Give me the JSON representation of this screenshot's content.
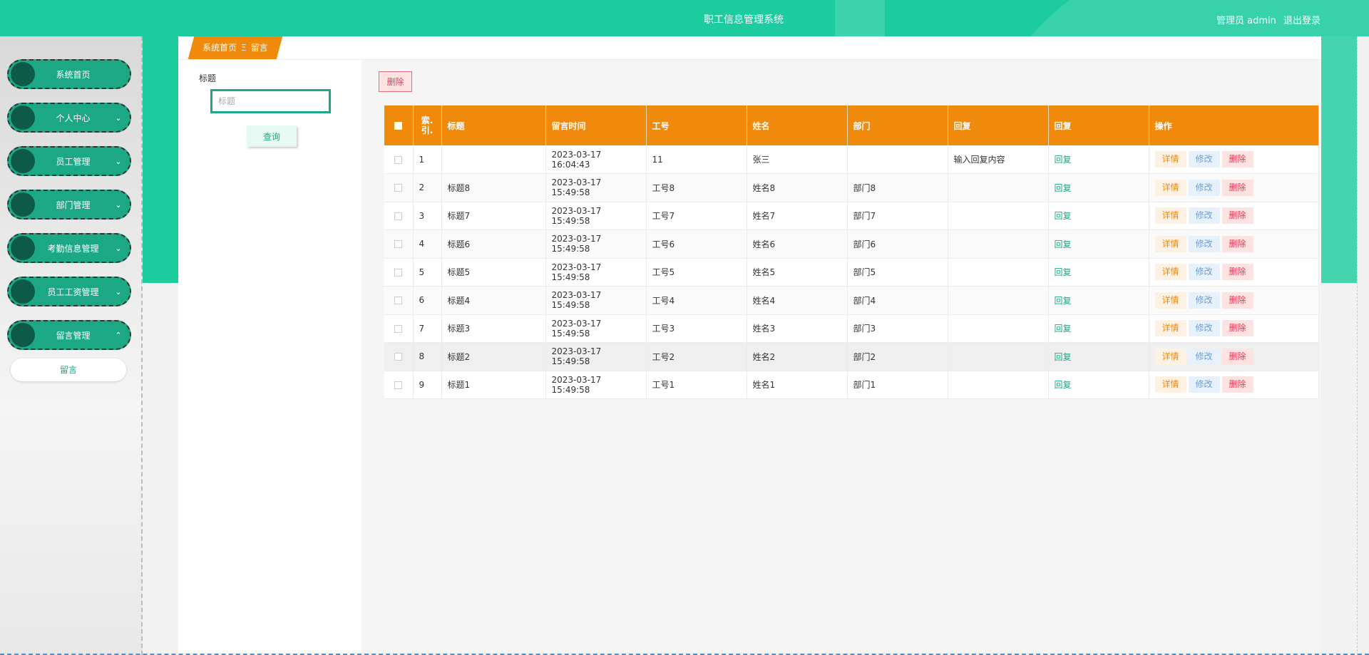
{
  "header": {
    "title": "职工信息管理系统",
    "role": "管理员 admin",
    "logout": "退出登录"
  },
  "sidebar": {
    "items": [
      {
        "label": "系统首页",
        "chevron": ""
      },
      {
        "label": "个人中心",
        "chevron": "⌄"
      },
      {
        "label": "员工管理",
        "chevron": "⌄"
      },
      {
        "label": "部门管理",
        "chevron": "⌄"
      },
      {
        "label": "考勤信息管理",
        "chevron": "⌄"
      },
      {
        "label": "员工工资管理",
        "chevron": "⌄"
      },
      {
        "label": "留言管理",
        "chevron": "⌃"
      }
    ],
    "sub_item": "留言"
  },
  "breadcrumb": {
    "home": "系统首页",
    "separator": "Ξ",
    "current": "留言"
  },
  "search": {
    "label": "标题",
    "placeholder": "标题",
    "query_button": "查询"
  },
  "toolbar": {
    "delete_button": "删除"
  },
  "table": {
    "headers": [
      "",
      "索引",
      "标题",
      "留言时间",
      "工号",
      "姓名",
      "部门",
      "回复",
      "回复",
      "操作"
    ],
    "index_header_l1": "索.",
    "index_header_l2": "引.",
    "rows": [
      {
        "idx": "1",
        "title": "",
        "time": "2023-03-17 16:04:43",
        "no": "11",
        "name": "张三",
        "dept": "",
        "reply": "输入回复内容",
        "reply_link": "回复"
      },
      {
        "idx": "2",
        "title": "标题8",
        "time": "2023-03-17 15:49:58",
        "no": "工号8",
        "name": "姓名8",
        "dept": "部门8",
        "reply": "",
        "reply_link": "回复"
      },
      {
        "idx": "3",
        "title": "标题7",
        "time": "2023-03-17 15:49:58",
        "no": "工号7",
        "name": "姓名7",
        "dept": "部门7",
        "reply": "",
        "reply_link": "回复"
      },
      {
        "idx": "4",
        "title": "标题6",
        "time": "2023-03-17 15:49:58",
        "no": "工号6",
        "name": "姓名6",
        "dept": "部门6",
        "reply": "",
        "reply_link": "回复"
      },
      {
        "idx": "5",
        "title": "标题5",
        "time": "2023-03-17 15:49:58",
        "no": "工号5",
        "name": "姓名5",
        "dept": "部门5",
        "reply": "",
        "reply_link": "回复"
      },
      {
        "idx": "6",
        "title": "标题4",
        "time": "2023-03-17 15:49:58",
        "no": "工号4",
        "name": "姓名4",
        "dept": "部门4",
        "reply": "",
        "reply_link": "回复"
      },
      {
        "idx": "7",
        "title": "标题3",
        "time": "2023-03-17 15:49:58",
        "no": "工号3",
        "name": "姓名3",
        "dept": "部门3",
        "reply": "",
        "reply_link": "回复"
      },
      {
        "idx": "8",
        "title": "标题2",
        "time": "2023-03-17 15:49:58",
        "no": "工号2",
        "name": "姓名2",
        "dept": "部门2",
        "reply": "",
        "reply_link": "回复"
      },
      {
        "idx": "9",
        "title": "标题1",
        "time": "2023-03-17 15:49:58",
        "no": "工号1",
        "name": "姓名1",
        "dept": "部门1",
        "reply": "",
        "reply_link": "回复"
      }
    ],
    "actions": {
      "detail": "详情",
      "edit": "修改",
      "delete": "删除"
    }
  },
  "colors": {
    "primary": "#1ccc9e",
    "menu": "#1ca885",
    "table_header": "#f08a0c",
    "danger": "#e03c5a"
  }
}
